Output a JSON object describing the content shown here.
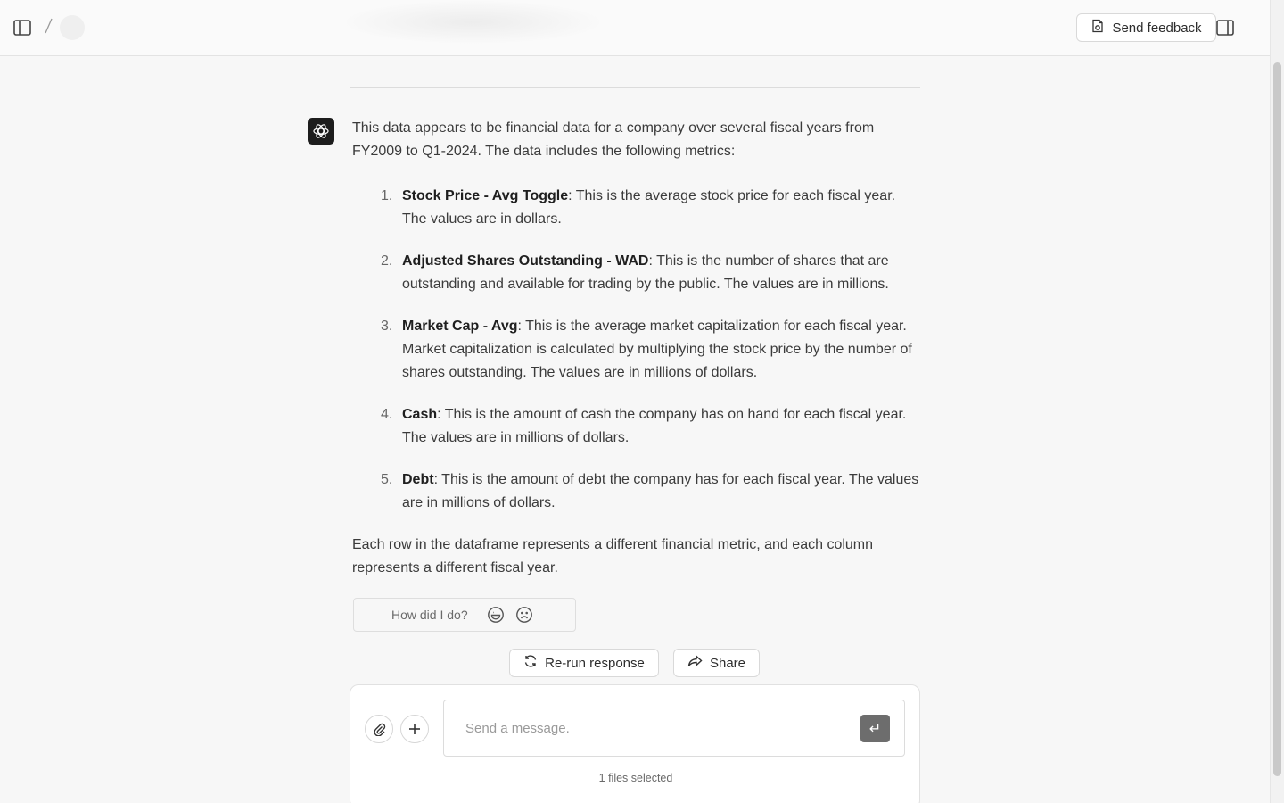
{
  "header": {
    "send_feedback_label": "Send feedback"
  },
  "message": {
    "intro": "This data appears to be financial data for a company over several fiscal years from FY2009 to Q1-2024. The data includes the following metrics:",
    "items": [
      {
        "num": "1.",
        "title": "Stock Price - Avg Toggle",
        "text": ": This is the average stock price for each fiscal year. The values are in dollars."
      },
      {
        "num": "2.",
        "title": "Adjusted Shares Outstanding - WAD",
        "text": ": This is the number of shares that are outstanding and available for trading by the public. The values are in millions."
      },
      {
        "num": "3.",
        "title": "Market Cap - Avg",
        "text": ": This is the average market capitalization for each fiscal year. Market capitalization is calculated by multiplying the stock price by the number of shares outstanding. The values are in millions of dollars."
      },
      {
        "num": "4.",
        "title": "Cash",
        "text": ": This is the amount of cash the company has on hand for each fiscal year. The values are in millions of dollars."
      },
      {
        "num": "5.",
        "title": "Debt",
        "text": ": This is the amount of debt the company has for each fiscal year. The values are in millions of dollars."
      }
    ],
    "closing": "Each row in the dataframe represents a different financial metric, and each column represents a different fiscal year."
  },
  "rating": {
    "prompt": "How did I do?"
  },
  "actions": {
    "rerun_label": "Re-run response",
    "share_label": "Share"
  },
  "composer": {
    "placeholder": "Send a message.",
    "send_glyph": "↵",
    "files_selected": "1 files selected"
  }
}
